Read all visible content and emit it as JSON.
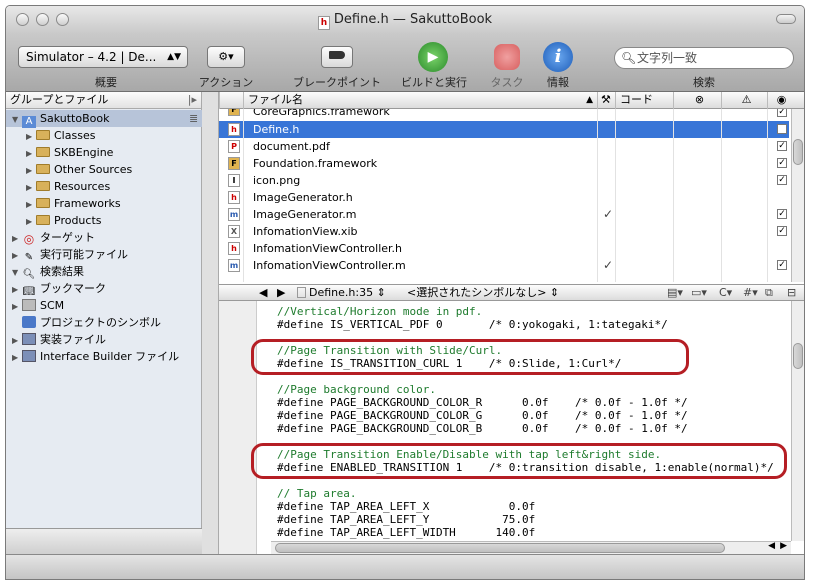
{
  "window": {
    "title": "Define.h — SakuttoBook",
    "title_icon": "h"
  },
  "toolbar": {
    "scheme": "Simulator – 4.2 | De...",
    "overview_label": "概要",
    "action_label": "アクション",
    "breakpoint_label": "ブレークポイント",
    "build_label": "ビルドと実行",
    "task_label": "タスク",
    "info_label": "情報",
    "search_label": "検索",
    "search_placeholder": "文字列一致"
  },
  "sidebar": {
    "header": "グループとファイル",
    "items": [
      {
        "label": "SakuttoBook"
      },
      {
        "label": "Classes"
      },
      {
        "label": "SKBEngine"
      },
      {
        "label": "Other Sources"
      },
      {
        "label": "Resources"
      },
      {
        "label": "Frameworks"
      },
      {
        "label": "Products"
      },
      {
        "label": "ターゲット"
      },
      {
        "label": "実行可能ファイル"
      },
      {
        "label": "検索結果"
      },
      {
        "label": "ブックマーク"
      },
      {
        "label": "SCM"
      },
      {
        "label": "プロジェクトのシンボル"
      },
      {
        "label": "実装ファイル"
      },
      {
        "label": "Interface Builder ファイル"
      }
    ]
  },
  "filelist": {
    "col_name": "ファイル名",
    "col_code": "コード",
    "rows": [
      {
        "name": "CoreGraphics.framework",
        "icon": "F"
      },
      {
        "name": "Define.h",
        "icon": "h"
      },
      {
        "name": "document.pdf",
        "icon": "P"
      },
      {
        "name": "Foundation.framework",
        "icon": "F"
      },
      {
        "name": "icon.png",
        "icon": "I"
      },
      {
        "name": "ImageGenerator.h",
        "icon": "h"
      },
      {
        "name": "ImageGenerator.m",
        "icon": "m"
      },
      {
        "name": "InfomationView.xib",
        "icon": "X"
      },
      {
        "name": "InfomationViewController.h",
        "icon": "h"
      },
      {
        "name": "InfomationViewController.m",
        "icon": "m"
      }
    ],
    "check": "✓"
  },
  "navbar": {
    "file": "Define.h:35",
    "symbol": "<選択されたシンボルなし>",
    "hash": "#"
  },
  "code": {
    "lines": [
      "//Vertical/Horizon mode in pdf.",
      "#define IS_VERTICAL_PDF 0       /* 0:yokogaki, 1:tategaki*/",
      "",
      "//Page Transition with Slide/Curl.",
      "#define IS_TRANSITION_CURL 1    /* 0:Slide, 1:Curl*/",
      "",
      "//Page background color.",
      "#define PAGE_BACKGROUND_COLOR_R      0.0f    /* 0.0f - 1.0f */",
      "#define PAGE_BACKGROUND_COLOR_G      0.0f    /* 0.0f - 1.0f */",
      "#define PAGE_BACKGROUND_COLOR_B      0.0f    /* 0.0f - 1.0f */",
      "",
      "//Page Transition Enable/Disable with tap left&right side.",
      "#define ENABLED_TRANSITION 1    /* 0:transition disable, 1:enable(normal)*/",
      "",
      "// Tap area.",
      "#define TAP_AREA_LEFT_X            0.0f",
      "#define TAP_AREA_LEFT_Y           75.0f",
      "#define TAP_AREA_LEFT_WIDTH      140.0f"
    ]
  },
  "colors": {
    "highlight": "#b51e24",
    "comment": "#1e7b2d",
    "selection": "#3875d7"
  }
}
